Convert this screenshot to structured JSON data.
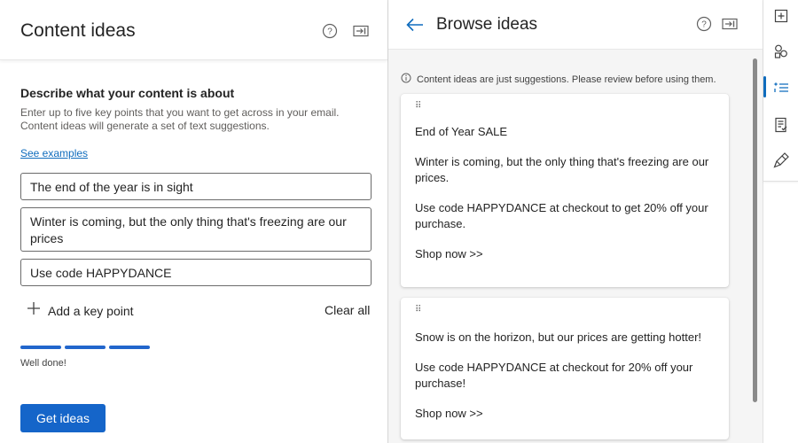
{
  "left_panel": {
    "title": "Content ideas",
    "help_icon": "help-circle-icon",
    "dock_icon": "dock-icon",
    "heading": "Describe what your content is about",
    "description": "Enter up to five key points that you want to get across in your email. Content ideas will generate a set of text suggestions.",
    "see_examples": "See examples",
    "key_points": [
      "The end of the year is in sight",
      "Winter is coming, but the only thing that's freezing are our prices",
      "Use code HAPPYDANCE"
    ],
    "add_key_point": "Add a key point",
    "clear_all": "Clear all",
    "progress": {
      "filled_segments": 3,
      "total_segments": 3,
      "message": "Well done!"
    },
    "get_ideas": "Get ideas"
  },
  "right_panel": {
    "title": "Browse ideas",
    "notice": "Content ideas are just suggestions. Please review before using them.",
    "cards": [
      {
        "drag_handle": "⠿",
        "lines": [
          "End of Year SALE",
          "Winter is coming, but the only thing that's freezing are our prices.",
          "Use code HAPPYDANCE at checkout to get 20% off your purchase.",
          "Shop now >>"
        ]
      },
      {
        "drag_handle": "⠿",
        "lines": [
          "Snow is on the horizon, but our prices are getting hotter!",
          "Use code HAPPYDANCE at checkout for 20% off your purchase!",
          "Shop now >>"
        ]
      }
    ]
  },
  "rail": {
    "icons": [
      "add-section-icon",
      "elements-icon",
      "content-ideas-icon",
      "checklist-icon",
      "design-brush-icon"
    ],
    "active_index": 2
  },
  "colors": {
    "accent": "#1565c9",
    "link": "#0f6cbd",
    "progress": "#2266cc"
  }
}
